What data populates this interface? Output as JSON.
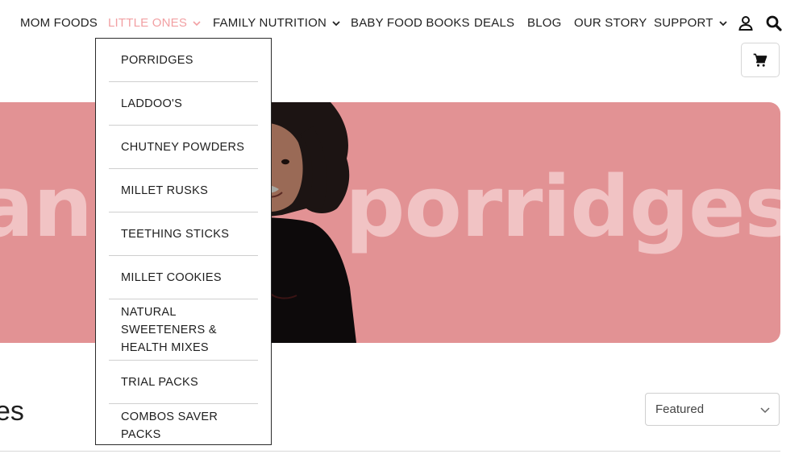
{
  "nav": {
    "items": [
      {
        "label": "MOM FOODS",
        "has_dropdown": false,
        "active": false
      },
      {
        "label": "LITTLE ONES",
        "has_dropdown": true,
        "active": true
      },
      {
        "label": "FAMILY NUTRITION",
        "has_dropdown": true,
        "active": false
      },
      {
        "label": "BABY FOOD BOOKS",
        "has_dropdown": false,
        "active": false
      },
      {
        "label": "DEALS",
        "has_dropdown": false,
        "active": false
      },
      {
        "label": "BLOG",
        "has_dropdown": false,
        "active": false
      },
      {
        "label": "OUR STORY",
        "has_dropdown": false,
        "active": false
      },
      {
        "label": "SUPPORT",
        "has_dropdown": true,
        "active": false
      }
    ],
    "icons": [
      "account-icon",
      "search-icon",
      "cart-icon"
    ],
    "active_color": "#f2a0a3"
  },
  "dropdown": {
    "items": [
      "PORRIDGES",
      "LADDOO'S",
      "CHUTNEY POWDERS",
      "MILLET RUSKS",
      "TEETHING STICKS",
      "MILLET COOKIES",
      "NATURAL SWEETENERS & HEALTH MIXES",
      "TRIAL PACKS",
      "COMBOS SAVER PACKS"
    ]
  },
  "hero": {
    "text_left": "an",
    "text_right": "porridges",
    "bg_color": "#e29294",
    "text_color": "#f1c3c4"
  },
  "page": {
    "title": "es"
  },
  "sort": {
    "selected": "Featured"
  }
}
